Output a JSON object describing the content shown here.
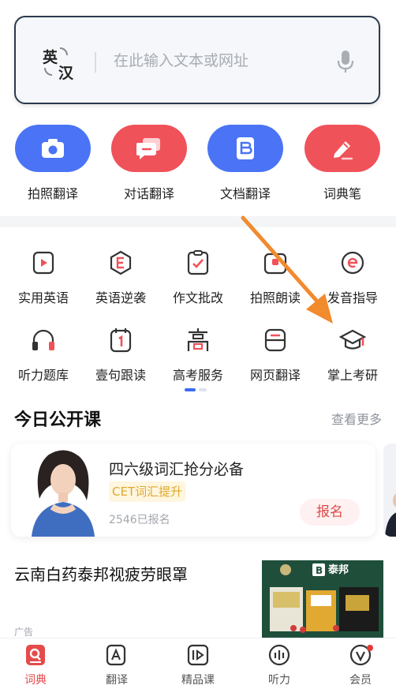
{
  "search": {
    "lang_source": "英",
    "lang_target": "汉",
    "placeholder": "在此输入文本或网址"
  },
  "primary_actions": [
    {
      "label": "拍照翻译",
      "icon": "camera-icon",
      "color": "#4a74f5"
    },
    {
      "label": "对话翻译",
      "icon": "chat-icon",
      "color": "#f0525a"
    },
    {
      "label": "文档翻译",
      "icon": "document-icon",
      "color": "#4a74f5"
    },
    {
      "label": "词典笔",
      "icon": "pen-icon",
      "color": "#f0525a"
    }
  ],
  "tools_row1": [
    {
      "label": "实用英语",
      "icon": "video-play-icon"
    },
    {
      "label": "英语逆袭",
      "icon": "letter-e-icon"
    },
    {
      "label": "作文批改",
      "icon": "clipboard-check-icon"
    },
    {
      "label": "拍照朗读",
      "icon": "camera-read-icon"
    },
    {
      "label": "发音指导",
      "icon": "pronunciation-icon"
    }
  ],
  "tools_row2": [
    {
      "label": "听力题库",
      "icon": "headphones-icon"
    },
    {
      "label": "壹句跟读",
      "icon": "calendar-one-icon"
    },
    {
      "label": "高考服务",
      "icon": "gaokao-icon"
    },
    {
      "label": "网页翻译",
      "icon": "webpage-icon"
    },
    {
      "label": "掌上考研",
      "icon": "graduation-cap-icon"
    }
  ],
  "courses": {
    "title": "今日公开课",
    "more": "查看更多",
    "card": {
      "title": "四六级词汇抢分必备",
      "tag": "CET词汇提升",
      "count": "2546已报名",
      "button": "报名"
    }
  },
  "ad": {
    "title": "云南白药泰邦视疲劳眼罩",
    "label": "广告",
    "brand": "泰邦"
  },
  "bottom_nav": [
    {
      "label": "词典",
      "icon": "dictionary-icon",
      "active": true
    },
    {
      "label": "翻译",
      "icon": "translate-icon",
      "active": false
    },
    {
      "label": "精品课",
      "icon": "course-icon",
      "active": false
    },
    {
      "label": "听力",
      "icon": "listening-icon",
      "active": false
    },
    {
      "label": "会员",
      "icon": "vip-icon",
      "active": false
    }
  ],
  "colors": {
    "accent_blue": "#4a74f5",
    "accent_red": "#f0525a",
    "annotation_arrow": "#f28a2e"
  }
}
